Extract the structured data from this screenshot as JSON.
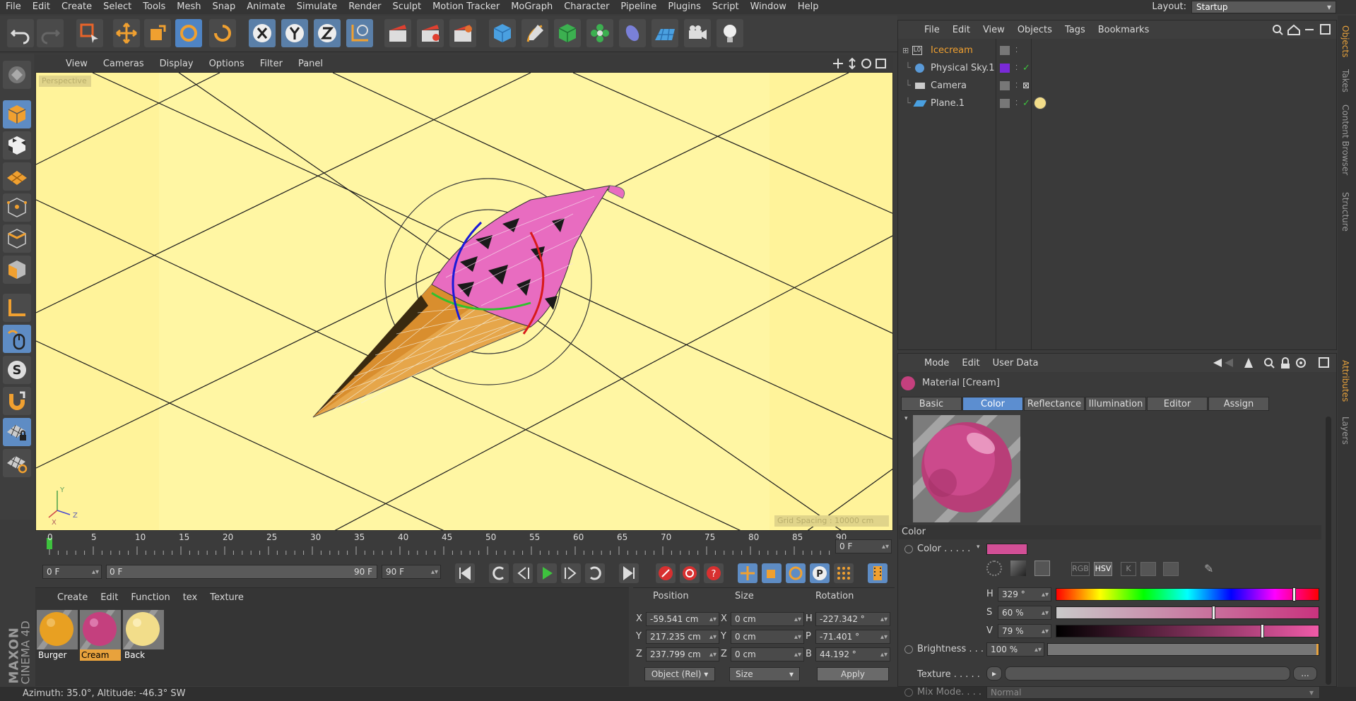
{
  "menu": [
    "File",
    "Edit",
    "Create",
    "Select",
    "Tools",
    "Mesh",
    "Snap",
    "Animate",
    "Simulate",
    "Render",
    "Sculpt",
    "Motion Tracker",
    "MoGraph",
    "Character",
    "Pipeline",
    "Plugins",
    "Script",
    "Window",
    "Help"
  ],
  "layout": {
    "label": "Layout:",
    "value": "Startup"
  },
  "viewport": {
    "menu": [
      "View",
      "Cameras",
      "Display",
      "Options",
      "Filter",
      "Panel"
    ],
    "label": "Perspective",
    "grid_label": "Grid Spacing : 10000 cm"
  },
  "timeline": {
    "ticks": [
      "0",
      "5",
      "10",
      "15",
      "20",
      "25",
      "30",
      "35",
      "40",
      "45",
      "50",
      "55",
      "60",
      "65",
      "70",
      "75",
      "80",
      "85",
      "90"
    ],
    "current_frame": "0 F"
  },
  "transport": {
    "start": "0 F",
    "range_start": "0 F",
    "range_end": "90 F",
    "end": "90 F"
  },
  "materials": {
    "menu": [
      "Create",
      "Edit",
      "Function",
      "tex",
      "Texture"
    ],
    "items": [
      {
        "name": "Burger",
        "color": "#e8a022"
      },
      {
        "name": "Cream",
        "color": "#c4407e"
      },
      {
        "name": "Back",
        "color": "#f2dd8a"
      }
    ]
  },
  "coords": {
    "headers": [
      "Position",
      "Size",
      "Rotation"
    ],
    "rows": [
      {
        "axis": "X",
        "pos": "-59.541 cm",
        "saxis": "X",
        "size": "0 cm",
        "raxis": "H",
        "rot": "-227.342 °"
      },
      {
        "axis": "Y",
        "pos": "217.235 cm",
        "saxis": "Y",
        "size": "0 cm",
        "raxis": "P",
        "rot": "-71.401 °"
      },
      {
        "axis": "Z",
        "pos": "237.799 cm",
        "saxis": "Z",
        "size": "0 cm",
        "raxis": "B",
        "rot": "44.192 °"
      }
    ],
    "mode": "Object (Rel)",
    "size_mode": "Size",
    "apply": "Apply"
  },
  "objects": {
    "menu": [
      "File",
      "Edit",
      "View",
      "Objects",
      "Tags",
      "Bookmarks"
    ],
    "items": [
      {
        "name": "Icecream",
        "highlight": true
      },
      {
        "name": "Physical Sky.1",
        "highlight": false
      },
      {
        "name": "Camera",
        "highlight": false
      },
      {
        "name": "Plane.1",
        "highlight": false
      }
    ]
  },
  "attributes": {
    "menu": [
      "Mode",
      "Edit",
      "User Data"
    ],
    "title": "Material [Cream]",
    "tabs": [
      "Basic",
      "Color",
      "Reflectance",
      "Illumination",
      "Editor",
      "Assign"
    ],
    "active_tab": "Color",
    "section": "Color",
    "color_label": "Color . . . . .",
    "color_swatch": "#d24f96",
    "color_modes": [
      "RGB",
      "HSV",
      "K"
    ],
    "h_label": "H",
    "h_value": "329 °",
    "h_fraction": 0.913,
    "s_label": "S",
    "s_value": "60 %",
    "s_fraction": 0.6,
    "v_label": "V",
    "v_value": "79 %",
    "v_fraction": 0.79,
    "brightness_label": "Brightness . . .",
    "brightness_value": "100 %",
    "texture_label": "Texture . . . . .",
    "texture_more": "...",
    "mixmode_label": "Mix Mode. . . .",
    "mixmode_value": "Normal"
  },
  "side_tabs_right_top": [
    "Objects",
    "Takes",
    "Content Browser",
    "Structure"
  ],
  "side_tabs_right_bottom": [
    "Attributes",
    "Layers"
  ],
  "brand": {
    "line1": "MAXON",
    "line2": "CINEMA 4D"
  },
  "status": "Azimuth: 35.0°, Altitude: -46.3°  SW"
}
